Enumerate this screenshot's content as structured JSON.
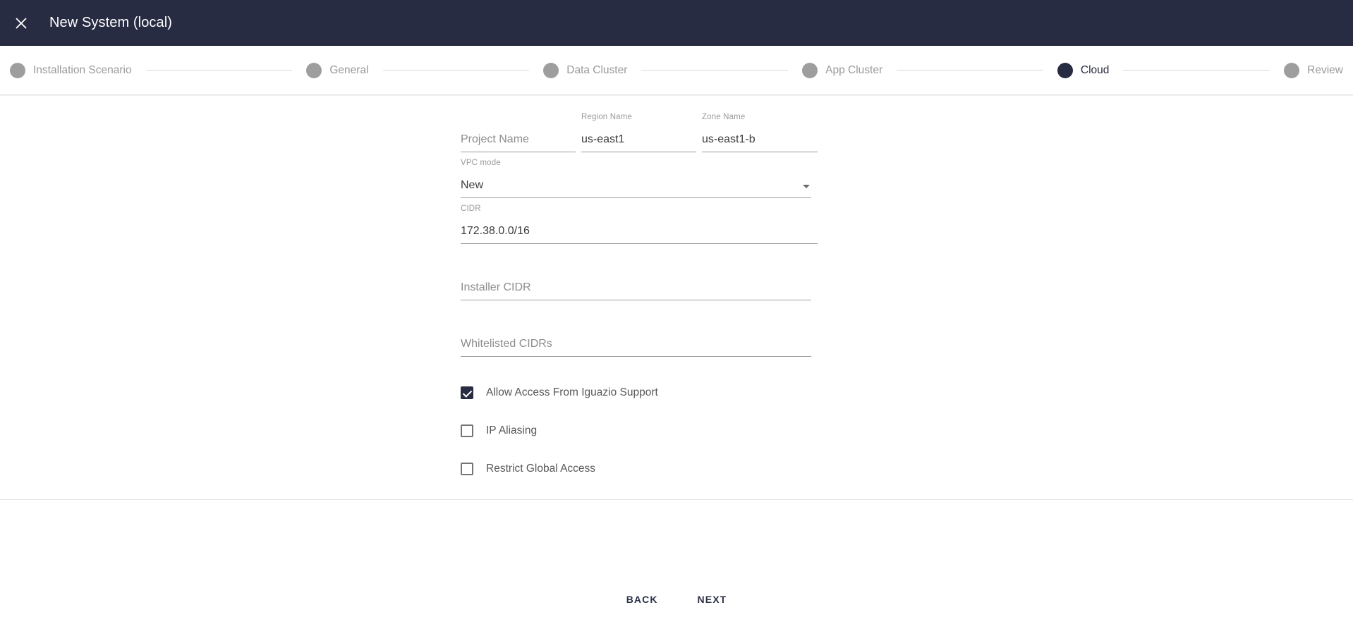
{
  "header": {
    "close_icon": "close-icon",
    "title": "New System (local)",
    "background": "#282c42"
  },
  "stepper": {
    "active_color": "#282c42",
    "inactive_color": "#9e9e9e",
    "steps": [
      {
        "label": "Installation Scenario",
        "active": false
      },
      {
        "label": "General",
        "active": false
      },
      {
        "label": "Data Cluster",
        "active": false
      },
      {
        "label": "App Cluster",
        "active": false
      },
      {
        "label": "Cloud",
        "active": true
      },
      {
        "label": "Review",
        "active": false
      }
    ]
  },
  "form": {
    "project_name": {
      "label": "Project Name",
      "value": "",
      "placeholder": "Project Name"
    },
    "region_name": {
      "label": "Region Name",
      "value": "us-east1",
      "placeholder": "Region Name"
    },
    "zone_name": {
      "label": "Zone Name",
      "value": "us-east1-b",
      "placeholder": "Zone Name"
    },
    "vpc_mode": {
      "label": "VPC mode",
      "value": "New",
      "placeholder": "VPC mode",
      "caret": "chevron-down-icon"
    },
    "cidr": {
      "label": "CIDR",
      "value": "172.38.0.0/16",
      "placeholder": "CIDR"
    },
    "installer_cidr": {
      "label": "Installer CIDR",
      "value": "",
      "placeholder": "Installer CIDR"
    },
    "whitelisted_cidrs": {
      "label": "Whitelisted CIDRs",
      "value": "",
      "placeholder": "Whitelisted CIDRs"
    }
  },
  "checkboxes": [
    {
      "label": "Allow Access From Iguazio Support",
      "checked": true
    },
    {
      "label": "IP Aliasing",
      "checked": false
    },
    {
      "label": "Restrict Global Access",
      "checked": false
    }
  ],
  "footer": {
    "back_label": "BACK",
    "next_label": "NEXT"
  }
}
